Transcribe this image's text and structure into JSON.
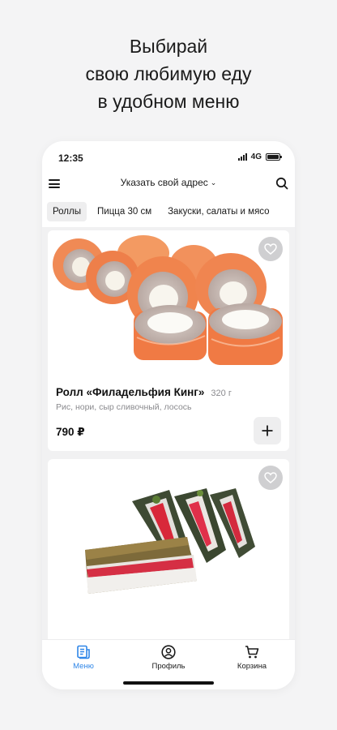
{
  "promo": {
    "line1": "Выбирай",
    "line2": "свою любимую еду",
    "line3": "в удобном меню"
  },
  "status_bar": {
    "time": "12:35",
    "network": "4G"
  },
  "header": {
    "menu_icon": "hamburger-icon",
    "address": "Указать свой адрес",
    "search_icon": "search-icon"
  },
  "categories": [
    {
      "label": "Роллы",
      "active": true
    },
    {
      "label": "Пицца 30 см",
      "active": false
    },
    {
      "label": "Закуски, салаты и мясо",
      "active": false
    }
  ],
  "products": [
    {
      "name": "Ролл «Филадельфия Кинг»",
      "weight": "320 г",
      "description": "Рис, нори, сыр сливочный, лосось",
      "price": "790 ₽"
    },
    {}
  ],
  "bottom_nav": [
    {
      "label": "Меню",
      "icon": "menu-document-icon",
      "active": true
    },
    {
      "label": "Профиль",
      "icon": "profile-icon",
      "active": false
    },
    {
      "label": "Корзина",
      "icon": "cart-icon",
      "active": false
    }
  ],
  "colors": {
    "accent": "#2f86e8",
    "salmon": "#f0804a"
  }
}
